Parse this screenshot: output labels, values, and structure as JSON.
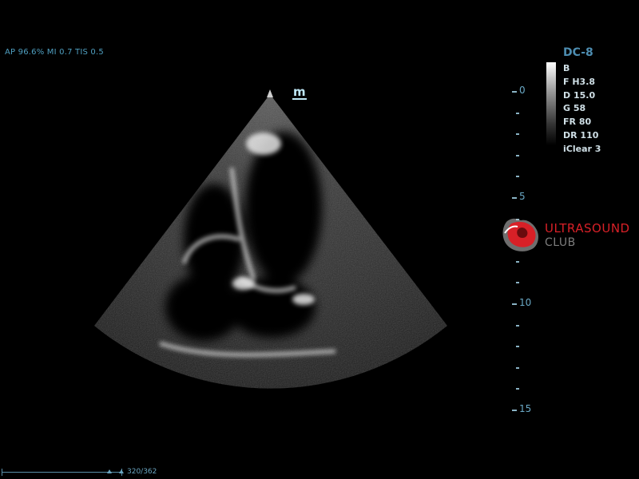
{
  "status_line": "AP 96.6%  MI 0.7 TIS 0.5",
  "orientation_marker": "m",
  "depth_scale": {
    "labels": [
      "0",
      "5",
      "10",
      "15"
    ],
    "unit_minor_tick": "-"
  },
  "imaging_params": {
    "preset": "DC-8",
    "mode": "B",
    "frequency": "F H3.8",
    "depth": "D 15.0",
    "gain": "G 58",
    "frame_rate": "FR 80",
    "dynamic_range": "DR 110",
    "iclear": "iClear 3"
  },
  "logo": {
    "line1": "ULTRASOUND",
    "line2": "CLUB",
    "colors": {
      "red": "#d82027",
      "gray": "#7c7c7c"
    }
  },
  "cine": {
    "frame_text": "320/362",
    "frame_current": 320,
    "frame_total": 362
  },
  "colors": {
    "accent": "#4d8db1",
    "overlay_text": "#6aa9c6",
    "background": "#000000"
  }
}
